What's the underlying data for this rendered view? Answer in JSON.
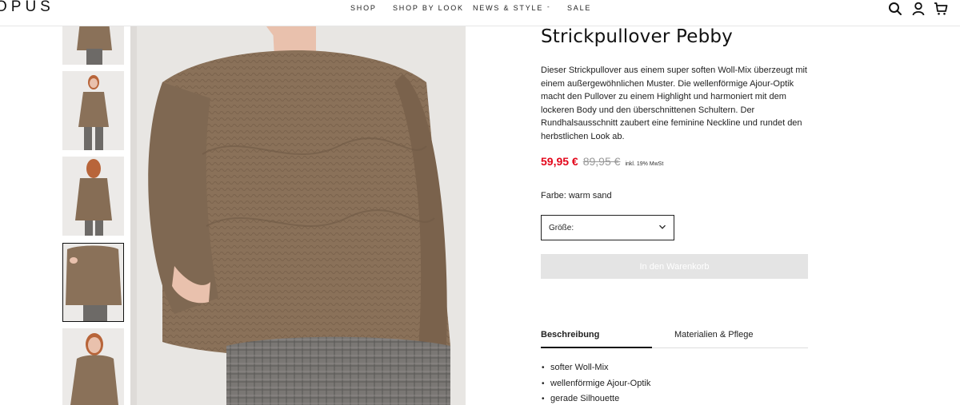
{
  "header": {
    "logo": "OPUS",
    "nav": {
      "shop": "SHOP",
      "shop_by_look": "SHOP BY LOOK",
      "news_style": "NEWS & STYLE",
      "separator": "-",
      "sale": "SALE"
    },
    "icons": [
      "search-icon",
      "user-icon",
      "shopping-bag-icon"
    ]
  },
  "gallery": {
    "thumbnails": [
      {
        "name": "thumbnail-1"
      },
      {
        "name": "thumbnail-2"
      },
      {
        "name": "thumbnail-3"
      },
      {
        "name": "thumbnail-4",
        "selected": true
      },
      {
        "name": "thumbnail-5"
      }
    ],
    "colors": {
      "sweater": "#8a7159",
      "sweater_dark": "#6f5a46",
      "background": "#e8e6e3",
      "skin": "#e9c1ad",
      "trousers": "#6d6a67"
    }
  },
  "product": {
    "title": "Strickpullover Pebby",
    "description": "Dieser Strickpullover aus einem super soften Woll-Mix überzeugt mit einem außergewöhnlichen Muster. Die wellenförmige Ajour-Optik macht den Pullover zu einem Highlight und harmoniert mit dem lockeren Body und den überschnittenen Schultern. Der Rundhalsausschnitt zaubert eine feminine Neckline und rundet den herbstlichen Look ab.",
    "price_sale": "59,95 €",
    "price_old": "89,95 €",
    "price_vat": "inkl. 19% MwSt",
    "color_label": "Farbe: warm sand",
    "size_select_label": "Größe:",
    "cart_button": "In den Warenkorb",
    "accent_color": "#e3061a"
  },
  "tabs": {
    "description": "Beschreibung",
    "materials": "Materialien & Pflege"
  },
  "features": [
    "softer Woll-Mix",
    "wellenförmige Ajour-Optik",
    "gerade Silhouette"
  ]
}
